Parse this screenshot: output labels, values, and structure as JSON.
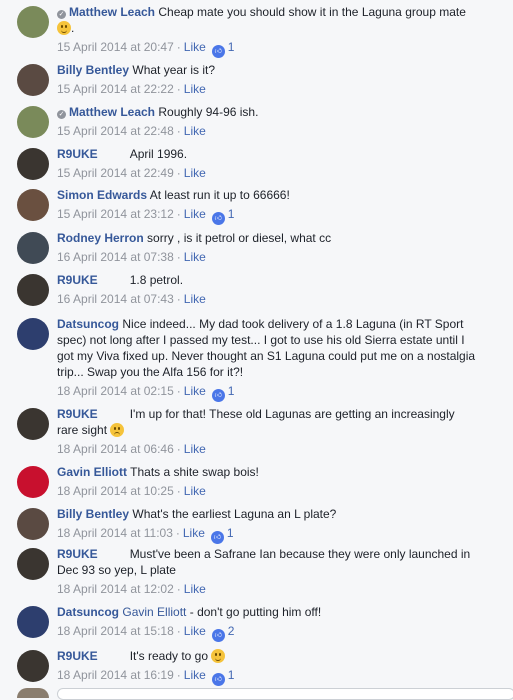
{
  "like_label": "Like",
  "comments": [
    {
      "name": "Matthew Leach",
      "verified": true,
      "text": "Cheap mate you should show it in the Laguna group mate",
      "text_after": ".",
      "emoji": "smile",
      "time": "15 April 2014 at 20:47",
      "likes": "1",
      "avatar_color": "#7a8a5a"
    },
    {
      "name": "Billy Bentley",
      "text": "What year is it?",
      "time": "15 April 2014 at 22:22",
      "avatar_color": "#5a4a42"
    },
    {
      "name": "Matthew Leach",
      "verified": true,
      "text": "Roughly 94-96 ish.",
      "time": "15 April 2014 at 22:48",
      "avatar_color": "#7a8a5a"
    },
    {
      "name": "R9UKE",
      "text": "April 1996.",
      "time": "15 April 2014 at 22:49",
      "avatar_color": "#3a3530"
    },
    {
      "name": "Simon Edwards",
      "text": "At least run it up to 66666!",
      "time": "15 April 2014 at 23:12",
      "likes": "1",
      "avatar_color": "#6a5040"
    },
    {
      "name": "Rodney Herron",
      "text": "sorry , is it petrol or diesel, what cc",
      "time": "16 April 2014 at 07:38",
      "avatar_color": "#404a55"
    },
    {
      "name": "R9UKE",
      "text": "1.8 petrol.",
      "time": "16 April 2014 at 07:43",
      "avatar_color": "#3a3530"
    },
    {
      "name": "Datsuncog",
      "text": "Nice indeed... My dad took delivery of a 1.8 Laguna (in RT Sport spec) not long after I passed my test... I got to use his old Sierra estate until I got my Viva fixed up. Never thought an S1 Laguna could put me on a nostalgia trip... Swap you the Alfa 156 for it?!",
      "time": "18 April 2014 at 02:15",
      "likes": "1",
      "avatar_color": "#2d3e6e"
    },
    {
      "name": "R9UKE",
      "text": "I'm up for that! These old Lagunas are getting an increasingly rare sight",
      "emoji": "sad",
      "time": "18 April 2014 at 06:46",
      "avatar_color": "#3a3530"
    },
    {
      "name": "Gavin Elliott",
      "text": "Thats a shite swap bois!",
      "time": "18 April 2014 at 10:25",
      "avatar_color": "#c8102e"
    },
    {
      "name": "Billy Bentley",
      "text": "What's the earliest Laguna an L plate?",
      "time": "18 April 2014 at 11:03",
      "likes": "1",
      "avatar_color": "#5a4a42"
    },
    {
      "name": "R9UKE",
      "text": "Must've been a Safrane Ian because they were only launched in Dec 93 so yep, L plate",
      "time": "18 April 2014 at 12:02",
      "avatar_color": "#3a3530"
    },
    {
      "name": "Datsuncog",
      "tag": "Gavin Elliott",
      "text": "- don't go putting him off!",
      "time": "18 April 2014 at 15:18",
      "likes": "2",
      "avatar_color": "#2d3e6e"
    },
    {
      "name": "R9UKE",
      "text": "It's ready to go",
      "emoji": "smile",
      "time": "18 April 2014 at 16:19",
      "likes": "1",
      "avatar_color": "#3a3530"
    }
  ]
}
